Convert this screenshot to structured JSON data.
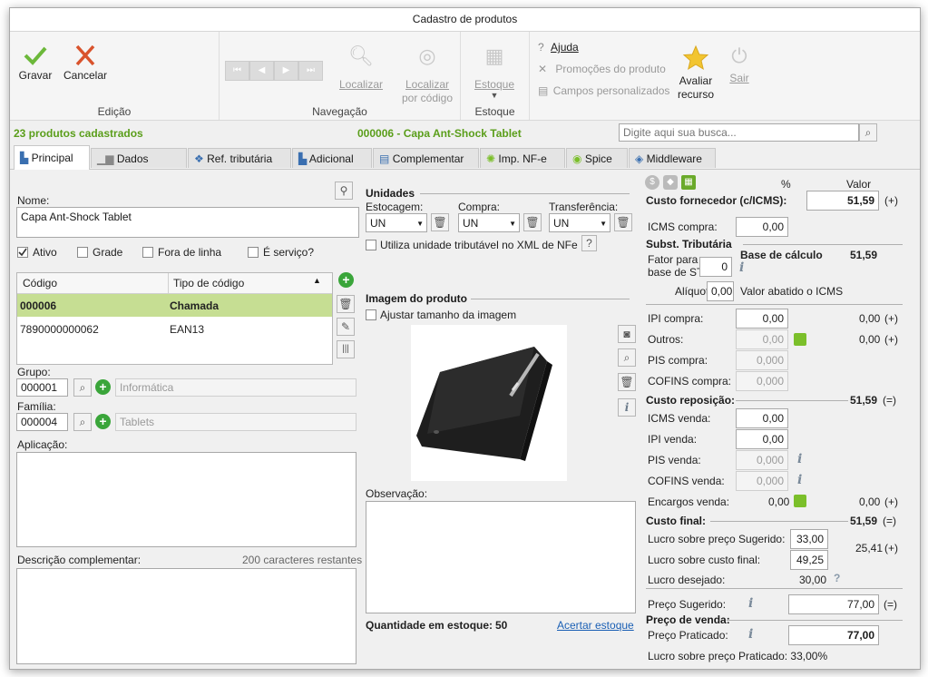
{
  "window": {
    "title": "Cadastro de produtos"
  },
  "ribbon": {
    "gravar": "Gravar",
    "cancelar": "Cancelar",
    "edicao": "Edição",
    "localizar": "Localizar",
    "localizar_codigo_1": "Localizar",
    "localizar_codigo_2": "por código",
    "navegacao": "Navegação",
    "estoque_btn": "Estoque",
    "estoque_group": "Estoque",
    "ajuda": "Ajuda",
    "promocoes": "Promoções do produto",
    "campos": "Campos personalizados",
    "avaliar_1": "Avaliar",
    "avaliar_2": "recurso",
    "sair": "Sair"
  },
  "info": {
    "count": "23 produtos cadastrados",
    "product": "000006 - Capa Ant-Shock Tablet",
    "search_placeholder": "Digite aqui sua busca..."
  },
  "tabs": [
    "Principal",
    "Dados Fiscais",
    "Ref. tributária",
    "Adicional",
    "Complementar",
    "Imp. NF-e",
    "Spice",
    "Middleware"
  ],
  "left": {
    "nome_label": "Nome:",
    "nome_value": "Capa Ant-Shock Tablet",
    "ativo": "Ativo",
    "grade": "Grade",
    "fora": "Fora de linha",
    "servico": "É serviço?",
    "grid_headers": [
      "Código",
      "Tipo de código"
    ],
    "grid_rows": [
      {
        "codigo": "000006",
        "tipo": "Chamada"
      },
      {
        "codigo": "7890000000062",
        "tipo": "EAN13"
      }
    ],
    "grupo_label": "Grupo:",
    "grupo_code": "000001",
    "grupo_name": "Informática",
    "familia_label": "Família:",
    "familia_code": "000004",
    "familia_name": "Tablets",
    "aplicacao_label": "Aplicação:",
    "descricao_label": "Descrição complementar:",
    "descricao_count": "200 caracteres restantes"
  },
  "middle": {
    "unidades": "Unidades",
    "estocagem": "Estocagem:",
    "compra": "Compra:",
    "transferencia": "Transferência:",
    "un_estocagem": "UN",
    "un_compra": "UN",
    "un_transferencia": "UN",
    "utiliza": "Utiliza unidade tributável no XML de NFe",
    "imagem": "Imagem do produto",
    "ajustar": "Ajustar tamanho da imagem",
    "observacao": "Observação:",
    "qtd_label": "Quantidade em estoque:",
    "qtd_value": "50",
    "acertar": "Acertar estoque"
  },
  "right": {
    "pct": "%",
    "valor": "Valor",
    "custo_fornecedor": "Custo fornecedor (c/ICMS):",
    "custo_fornecedor_val": "51,59",
    "plus": "(+)",
    "eq": "(=)",
    "icms_compra": "ICMS compra:",
    "icms_compra_val": "0,00",
    "subst": "Subst. Tributária",
    "fator_1": "Fator para",
    "fator_2": "base de ST",
    "fator_val": "0",
    "base_calc": "Base de cálculo",
    "base_calc_val": "51,59",
    "aliquota": "Alíquota",
    "aliquota_val": "0,00",
    "valor_abatido": "Valor abatido o ICMS",
    "ipi_compra": "IPI compra:",
    "ipi_compra_val": "0,00",
    "ipi_compra_res": "0,00",
    "outros": "Outros:",
    "outros_val": "0,00",
    "outros_res": "0,00",
    "pis_compra": "PIS compra:",
    "pis_compra_val": "0,000",
    "cofins_compra": "COFINS compra:",
    "cofins_compra_val": "0,000",
    "custo_reposicao": "Custo reposição:",
    "custo_reposicao_val": "51,59",
    "icms_venda": "ICMS venda:",
    "icms_venda_val": "0,00",
    "ipi_venda": "IPI venda:",
    "ipi_venda_val": "0,00",
    "pis_venda": "PIS venda:",
    "pis_venda_val": "0,000",
    "cofins_venda": "COFINS venda:",
    "cofins_venda_val": "0,000",
    "encargos": "Encargos venda:",
    "encargos_val": "0,00",
    "encargos_res": "0,00",
    "custo_final": "Custo final:",
    "custo_final_val": "51,59",
    "lucro_sug": "Lucro sobre preço Sugerido:",
    "lucro_sug_val": "33,00",
    "lucro_custo": "Lucro sobre custo final:",
    "lucro_custo_val": "49,25",
    "lucro_res": "25,41",
    "lucro_desejado": "Lucro desejado:",
    "lucro_desejado_val": "30,00",
    "question": "?",
    "preco_sugerido": "Preço Sugerido:",
    "preco_sugerido_val": "77,00",
    "preco_venda": "Preço de venda:",
    "preco_praticado": "Preço Praticado:",
    "preco_praticado_val": "77,00",
    "lucro_praticado": "Lucro sobre preço Praticado: 33,00%"
  }
}
